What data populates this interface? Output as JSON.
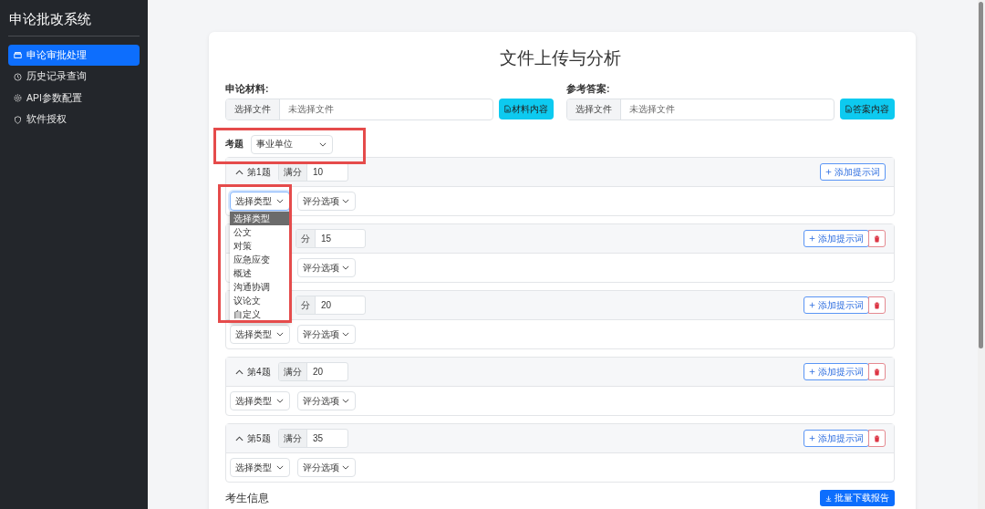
{
  "sidebar": {
    "title": "申论批改系统",
    "items": [
      {
        "label": "申论审批处理",
        "selected": true
      },
      {
        "label": "历史记录查询",
        "selected": false
      },
      {
        "label": "API参数配置",
        "selected": false
      },
      {
        "label": "软件授权",
        "selected": false
      }
    ]
  },
  "page_title": "文件上传与分析",
  "uploads": [
    {
      "label": "申论材料:",
      "choose": "选择文件",
      "placeholder": "未选择文件",
      "button": "材料内容"
    },
    {
      "label": "参考答案:",
      "choose": "选择文件",
      "placeholder": "未选择文件",
      "button": "答案内容"
    }
  ],
  "exam": {
    "label": "考题",
    "value": "事业单位"
  },
  "questions": [
    {
      "title": "第1题",
      "score_label": "满分",
      "score": "10",
      "type_select": "选择类型",
      "grading_select": "评分选项",
      "add_button": "添加提示词",
      "deletable": false,
      "type_dropdown": [
        {
          "label": "选择类型",
          "selected": true
        },
        {
          "label": "公文",
          "selected": false
        },
        {
          "label": "对策",
          "selected": false
        },
        {
          "label": "应急应变",
          "selected": false
        },
        {
          "label": "概述",
          "selected": false
        },
        {
          "label": "沟通协调",
          "selected": false
        },
        {
          "label": "议论文",
          "selected": false
        },
        {
          "label": "自定义",
          "selected": false
        }
      ]
    },
    {
      "score_label": "分",
      "score": "15",
      "grading_select": "评分选项",
      "add_button": "添加提示词",
      "deletable": true
    },
    {
      "score_label": "分",
      "score": "20",
      "type_select": "选择类型",
      "grading_select": "评分选项",
      "add_button": "添加提示词",
      "deletable": true
    },
    {
      "title": "第4题",
      "score_label": "满分",
      "score": "20",
      "type_select": "选择类型",
      "grading_select": "评分选项",
      "add_button": "添加提示词",
      "deletable": true
    },
    {
      "title": "第5题",
      "score_label": "满分",
      "score": "35",
      "type_select": "选择类型",
      "grading_select": "评分选项",
      "add_button": "添加提示词",
      "deletable": true
    }
  ],
  "candidates": {
    "title": "考生信息",
    "button": "批量下载报告"
  }
}
